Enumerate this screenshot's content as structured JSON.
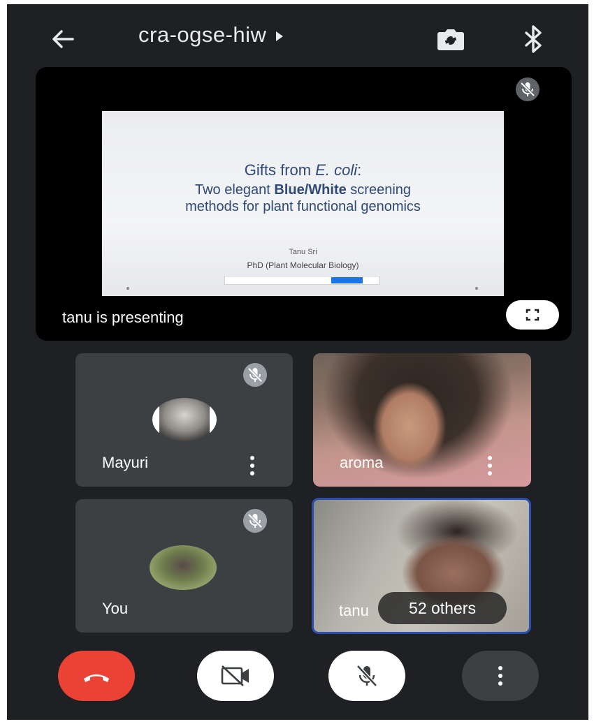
{
  "header": {
    "meeting_code": "cra-ogse-hiw",
    "icons": [
      "back-arrow-icon",
      "play-arrow-icon",
      "switch-camera-icon",
      "bluetooth-icon"
    ]
  },
  "presentation": {
    "slide": {
      "title_prefix": "Gifts from ",
      "title_italic": "E. coli",
      "title_suffix": ":",
      "subtitle_1_prefix": "Two elegant ",
      "subtitle_1_bold": "Blue/White",
      "subtitle_1_suffix": " screening",
      "subtitle_2": "methods for plant functional genomics",
      "author": "Tanu Sri",
      "degree": "PhD (Plant Molecular Biology)"
    },
    "caption": "tanu is presenting"
  },
  "participants": [
    {
      "name": "Mayuri",
      "muted": true
    },
    {
      "name": "aroma",
      "muted": false
    },
    {
      "name": "You",
      "muted": true
    },
    {
      "name": "tanu",
      "muted": false
    }
  ],
  "others_label": "52 others",
  "colors": {
    "background": "#1f2023",
    "tile": "#3c4043",
    "end_call": "#ea4335",
    "active_speaker_border": "#2a4fae"
  }
}
